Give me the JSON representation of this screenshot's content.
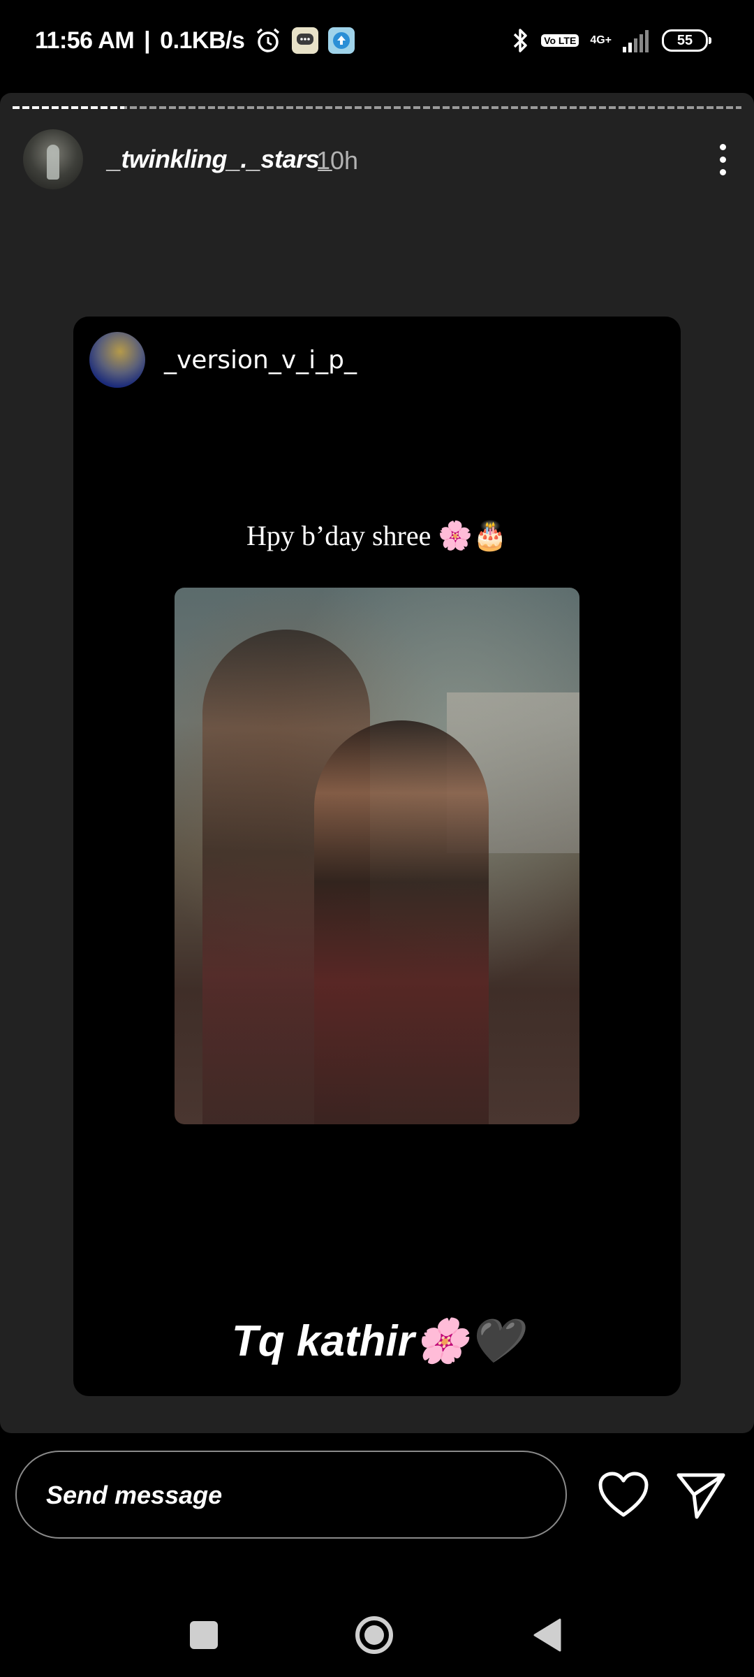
{
  "status_bar": {
    "time": "11:56 AM",
    "separator": "|",
    "net_speed": "0.1KB/s",
    "volte": "Vo LTE",
    "network": "4G+",
    "battery": "55"
  },
  "story": {
    "progress_segments": "first of several",
    "owner_username": "_twinkling_._stars_",
    "time_ago": "10h",
    "shared_post": {
      "username": "_version_v_i_p_",
      "text": "Hpy b’day shree 🌸🎂"
    },
    "caption": "Tq kathir🌸🖤"
  },
  "reply": {
    "placeholder": "Send message"
  },
  "colors": {
    "background": "#000000",
    "story_panel": "#222222",
    "card": "#000000",
    "text": "#ffffff",
    "muted": "#b3b3b3"
  }
}
